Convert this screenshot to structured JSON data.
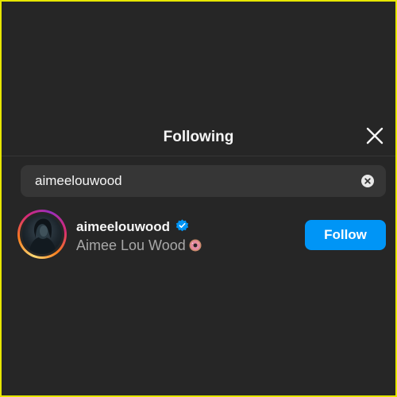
{
  "modal": {
    "title": "Following",
    "close_icon": "close-icon"
  },
  "search": {
    "value": "aimeelouwood",
    "clear_icon": "clear-circle-icon"
  },
  "results": [
    {
      "username": "aimeelouwood",
      "verified": true,
      "full_name": "Aimee Lou Wood",
      "emoji_icon": "doughnut-emoji-icon",
      "follow_label": "Follow"
    }
  ],
  "colors": {
    "background": "#262626",
    "search_bg": "#363636",
    "follow_button": "#0095f6",
    "verified_badge": "#0095f6",
    "secondary_text": "#a8a8a8",
    "frame_border": "#e6e600"
  }
}
